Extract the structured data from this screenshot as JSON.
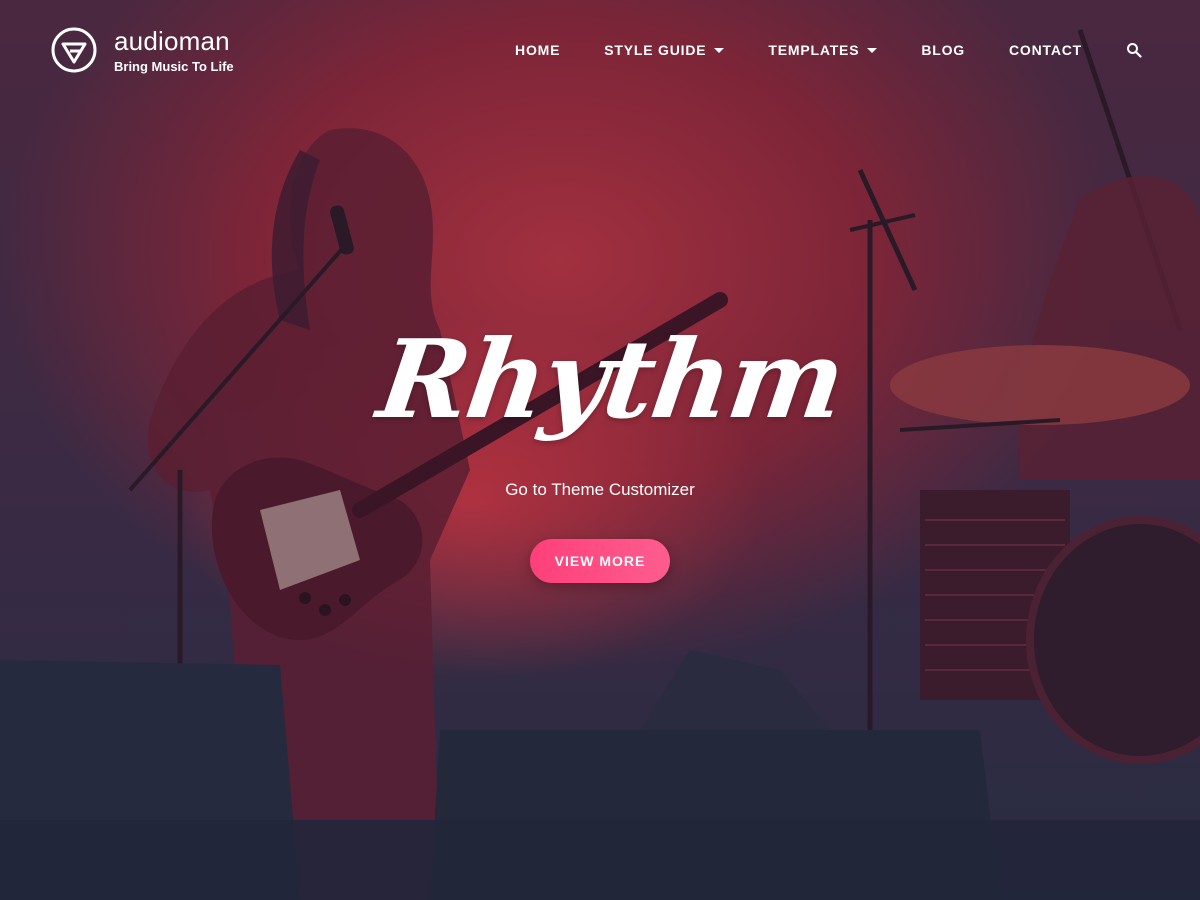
{
  "brand": {
    "title": "audioman",
    "tagline": "Bring Music To Life",
    "logo_icon": "triangle-play-circle-icon"
  },
  "nav": {
    "items": [
      {
        "label": "HOME",
        "dropdown": false
      },
      {
        "label": "STYLE GUIDE",
        "dropdown": true
      },
      {
        "label": "TEMPLATES",
        "dropdown": true
      },
      {
        "label": "BLOG",
        "dropdown": false
      },
      {
        "label": "CONTACT",
        "dropdown": false
      }
    ],
    "search_icon": "search-icon"
  },
  "hero": {
    "title": "Rhythm",
    "subtitle": "Go to Theme Customizer",
    "button_label": "VIEW MORE"
  },
  "colors": {
    "accent": "#ff4f86",
    "overlay_red": "#a2303f",
    "overlay_dark": "#272c42"
  }
}
